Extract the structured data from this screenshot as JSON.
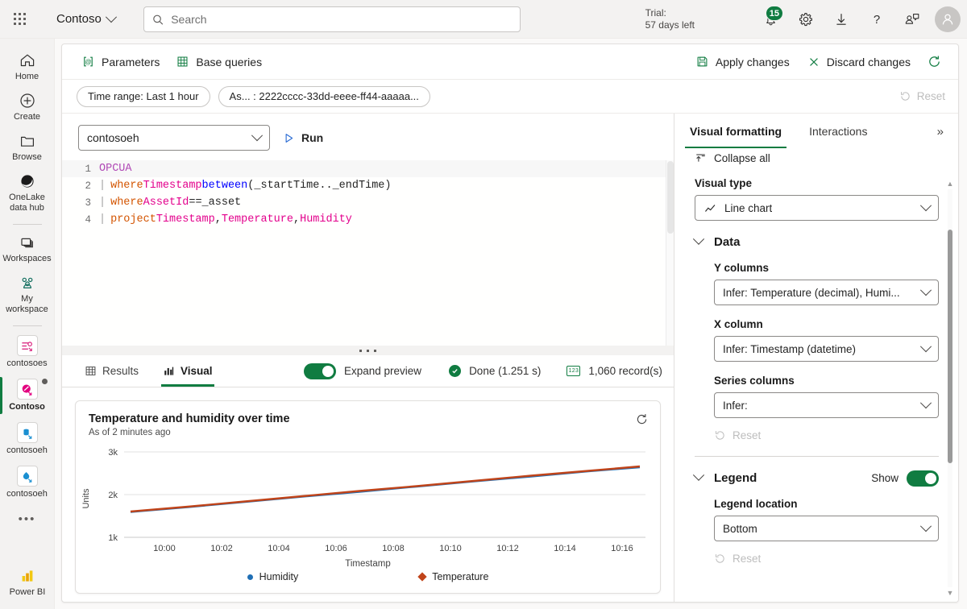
{
  "topbar": {
    "waffle_icon": "app-launcher-icon",
    "brand": "Contoso",
    "search_placeholder": "Search",
    "search_value": "",
    "trial_line1": "Trial:",
    "trial_line2": "57 days left",
    "notification_count": "15",
    "icons": [
      "bell-icon",
      "gear-icon",
      "download-icon",
      "help-icon",
      "feedback-icon",
      "avatar"
    ]
  },
  "rail": {
    "items": [
      {
        "label": "Home",
        "icon": "home-icon",
        "active": false
      },
      {
        "label": "Create",
        "icon": "plus-circle-icon",
        "active": false
      },
      {
        "label": "Browse",
        "icon": "folder-icon",
        "active": false
      },
      {
        "label": "OneLake data hub",
        "icon": "onelake-icon",
        "active": false
      },
      {
        "label": "Workspaces",
        "icon": "workspaces-icon",
        "active": false
      },
      {
        "label": "My workspace",
        "icon": "people-icon",
        "active": false
      },
      {
        "label": "contosoes",
        "icon": "eventstream-icon",
        "active": false
      },
      {
        "label": "Contoso",
        "icon": "realtime-dashboard-icon",
        "active": true
      },
      {
        "label": "contosoeh",
        "icon": "eventhouse-icon",
        "active": false
      },
      {
        "label": "contosoeh",
        "icon": "kqldatabase-icon",
        "active": false
      }
    ],
    "more": "•••",
    "footer_label": "Power BI",
    "footer_icon": "powerbi-icon"
  },
  "command_bar": {
    "parameters_label": "Parameters",
    "parameters_icon": "at-brackets-icon",
    "base_queries_label": "Base queries",
    "base_queries_icon": "table-grid-icon",
    "apply_label": "Apply changes",
    "apply_icon": "save-icon",
    "discard_label": "Discard changes",
    "discard_icon": "close-icon",
    "refresh_icon": "refresh-icon"
  },
  "filter_bar": {
    "pills": [
      "Time range: Last 1 hour",
      "As... : 2222cccc-33dd-eeee-ff44-aaaaa..."
    ],
    "reset_label": "Reset",
    "reset_icon": "undo-icon"
  },
  "query": {
    "database_value": "contosoeh",
    "run_label": "Run",
    "run_icon": "play-icon",
    "lines": [
      {
        "num": "1",
        "tokens": [
          {
            "t": "OPCUA",
            "c": "k-cmd"
          }
        ]
      },
      {
        "num": "2",
        "tokens": [
          {
            "t": "where ",
            "c": "k-op"
          },
          {
            "t": "Timestamp ",
            "c": "k-fn"
          },
          {
            "t": "between ",
            "c": "k-blue"
          },
          {
            "t": "(_startTime.._endTime)",
            "c": "k-txt"
          }
        ]
      },
      {
        "num": "3",
        "tokens": [
          {
            "t": "where ",
            "c": "k-op"
          },
          {
            "t": "AssetId ",
            "c": "k-fn"
          },
          {
            "t": "== ",
            "c": "k-txt"
          },
          {
            "t": "_asset",
            "c": "k-txt"
          }
        ]
      },
      {
        "num": "4",
        "tokens": [
          {
            "t": "project ",
            "c": "k-op"
          },
          {
            "t": "Timestamp",
            "c": "k-fn"
          },
          {
            "t": ", ",
            "c": "k-txt"
          },
          {
            "t": "Temperature",
            "c": "k-fn"
          },
          {
            "t": ", ",
            "c": "k-txt"
          },
          {
            "t": "Humidity",
            "c": "k-fn"
          }
        ]
      }
    ]
  },
  "results": {
    "tabs": [
      {
        "label": "Results",
        "icon": "table-icon",
        "active": false
      },
      {
        "label": "Visual",
        "icon": "chart-icon",
        "active": true
      }
    ],
    "expand_preview_label": "Expand preview",
    "expand_preview_on": true,
    "status_label": "Done (1.251 s)",
    "status_icon": "check-circle-icon",
    "records_label": "1,060 record(s)",
    "records_icon": "number-icon"
  },
  "chart_data": {
    "type": "line",
    "title": "Temperature and humidity over time",
    "subtitle": "As of 2 minutes ago",
    "xlabel": "Timestamp",
    "ylabel": "Units",
    "xticks": [
      "10:00",
      "10:02",
      "10:04",
      "10:06",
      "10:08",
      "10:10",
      "10:12",
      "10:14",
      "10:16"
    ],
    "yticks": [
      "1k",
      "2k",
      "3k"
    ],
    "ylim": [
      1000,
      3000
    ],
    "grid": true,
    "legend_position": "bottom",
    "series": [
      {
        "name": "Humidity",
        "color": "#1f6fb5",
        "marker": "circle",
        "x": [
          "09:59",
          "10:01",
          "10:03",
          "10:05",
          "10:07",
          "10:09",
          "10:11",
          "10:13",
          "10:15",
          "10:17"
        ],
        "values": [
          1680,
          1790,
          1900,
          2010,
          2120,
          2230,
          2340,
          2450,
          2560,
          2660
        ]
      },
      {
        "name": "Temperature",
        "color": "#c0441a",
        "marker": "diamond",
        "x": [
          "09:59",
          "10:01",
          "10:03",
          "10:05",
          "10:07",
          "10:09",
          "10:11",
          "10:13",
          "10:15",
          "10:17"
        ],
        "values": [
          1690,
          1800,
          1910,
          2020,
          2130,
          2240,
          2350,
          2460,
          2570,
          2670
        ]
      }
    ],
    "refresh_icon": "refresh-icon"
  },
  "right_panel": {
    "tabs": [
      {
        "label": "Visual formatting",
        "active": true
      },
      {
        "label": "Interactions",
        "active": false
      }
    ],
    "expand_icon": "chevron-double-right-icon",
    "collapse_all_label": "Collapse all",
    "collapse_all_icon": "collapse-icon",
    "visual_type_label": "Visual type",
    "visual_type_value": "Line chart",
    "visual_type_icon": "line-chart-icon",
    "data_section_title": "Data",
    "y_columns_label": "Y columns",
    "y_columns_value": "Infer: Temperature (decimal), Humi...",
    "x_column_label": "X column",
    "x_column_value": "Infer: Timestamp (datetime)",
    "series_columns_label": "Series columns",
    "series_columns_value": "Infer:",
    "data_reset_label": "Reset",
    "legend_section_title": "Legend",
    "legend_show_label": "Show",
    "legend_show_on": true,
    "legend_location_label": "Legend location",
    "legend_location_value": "Bottom",
    "legend_reset_label": "Reset"
  },
  "colors": {
    "accent_green": "#107c41",
    "temperature": "#c0441a",
    "humidity": "#1f6fb5"
  }
}
